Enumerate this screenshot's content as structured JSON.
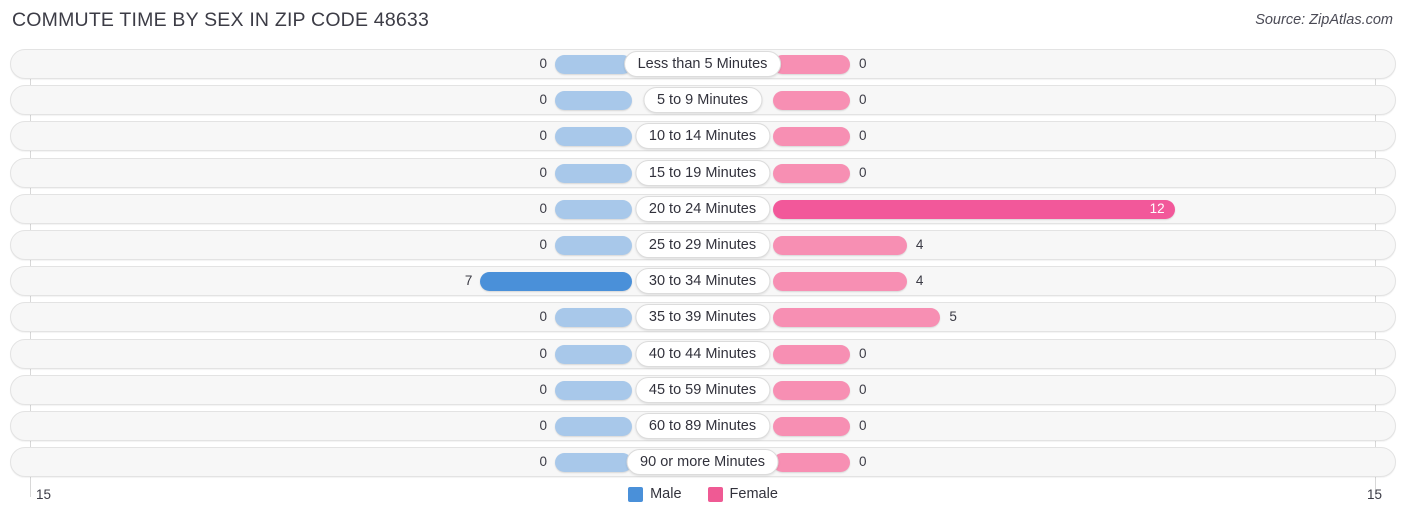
{
  "header": {
    "title": "COMMUTE TIME BY SEX IN ZIP CODE 48633",
    "source": "Source: ZipAtlas.com"
  },
  "axis": {
    "left_label": "15",
    "right_label": "15"
  },
  "legend": {
    "items": [
      {
        "label": "Male",
        "color": "#4a90d9"
      },
      {
        "label": "Female",
        "color": "#ef5a94"
      }
    ]
  },
  "colors": {
    "male_light": "#a8c8ea",
    "male_strong": "#4a90d9",
    "female_light": "#f78fb3",
    "female_strong": "#f2589a",
    "track": "#f7f7f7",
    "track_border": "#e3e3e3",
    "gridline": "#d8d8d8",
    "text": "#3c3c46"
  },
  "chart_data": {
    "type": "bar",
    "subtype": "diverging-bidirectional-bar",
    "title": "COMMUTE TIME BY SEX IN ZIP CODE 48633",
    "xlabel": "",
    "ylabel": "",
    "xlim": [
      15,
      15
    ],
    "axis_max": 15,
    "grid": true,
    "legend_position": "bottom-center",
    "categories": [
      "Less than 5 Minutes",
      "5 to 9 Minutes",
      "10 to 14 Minutes",
      "15 to 19 Minutes",
      "20 to 24 Minutes",
      "25 to 29 Minutes",
      "30 to 34 Minutes",
      "35 to 39 Minutes",
      "40 to 44 Minutes",
      "45 to 59 Minutes",
      "60 to 89 Minutes",
      "90 or more Minutes"
    ],
    "series": [
      {
        "name": "Male",
        "direction": "left",
        "values": [
          0,
          0,
          0,
          0,
          0,
          0,
          7,
          0,
          0,
          0,
          0,
          0
        ]
      },
      {
        "name": "Female",
        "direction": "right",
        "values": [
          0,
          0,
          0,
          0,
          12,
          4,
          4,
          5,
          0,
          0,
          0,
          0
        ]
      }
    ]
  },
  "rows": [
    {
      "category": "Less than 5 Minutes",
      "male": "0",
      "female": "0"
    },
    {
      "category": "5 to 9 Minutes",
      "male": "0",
      "female": "0"
    },
    {
      "category": "10 to 14 Minutes",
      "male": "0",
      "female": "0"
    },
    {
      "category": "15 to 19 Minutes",
      "male": "0",
      "female": "0"
    },
    {
      "category": "20 to 24 Minutes",
      "male": "0",
      "female": "12"
    },
    {
      "category": "25 to 29 Minutes",
      "male": "0",
      "female": "4"
    },
    {
      "category": "30 to 34 Minutes",
      "male": "7",
      "female": "4"
    },
    {
      "category": "35 to 39 Minutes",
      "male": "0",
      "female": "5"
    },
    {
      "category": "40 to 44 Minutes",
      "male": "0",
      "female": "0"
    },
    {
      "category": "45 to 59 Minutes",
      "male": "0",
      "female": "0"
    },
    {
      "category": "60 to 89 Minutes",
      "male": "0",
      "female": "0"
    },
    {
      "category": "90 or more Minutes",
      "male": "0",
      "female": "0"
    }
  ]
}
